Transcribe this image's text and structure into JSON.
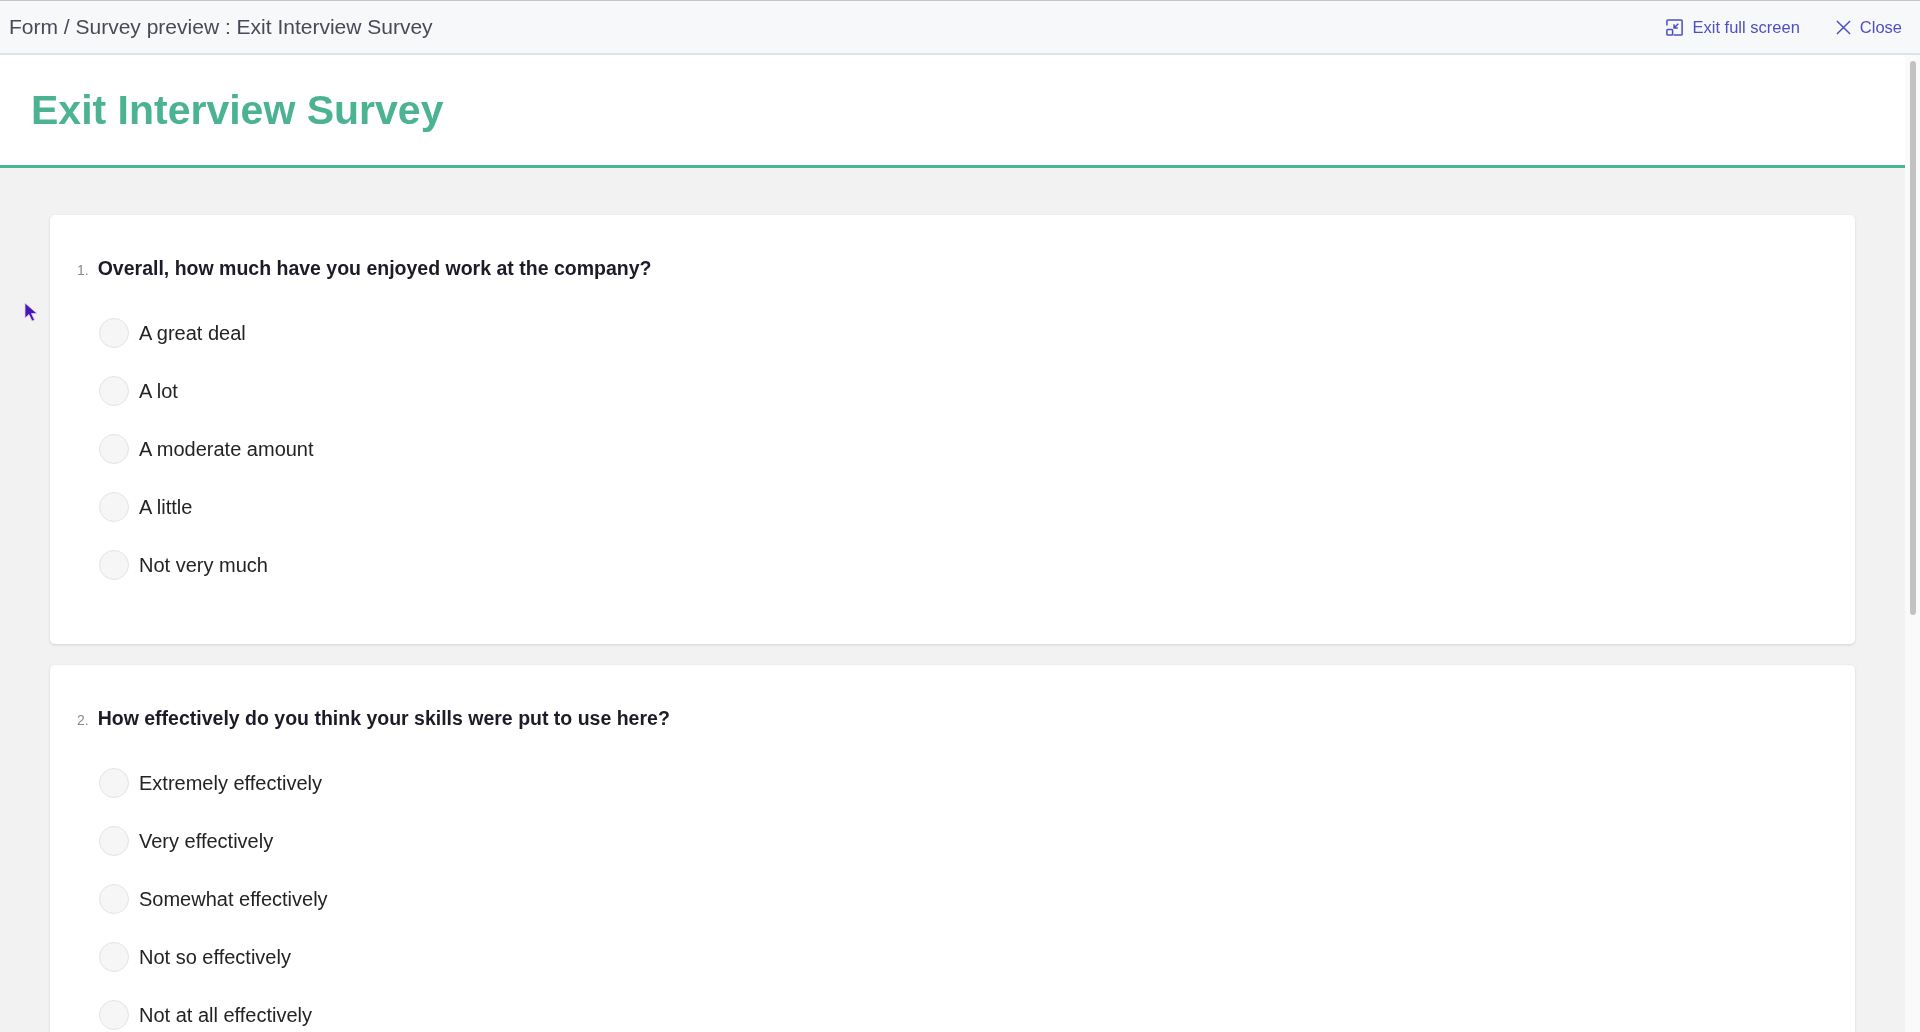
{
  "top_bar": {
    "breadcrumb": "Form / Survey preview : Exit Interview Survey",
    "actions": [
      {
        "kind": "exit_full_screen",
        "label": "Exit full screen"
      },
      {
        "kind": "close",
        "label": "Close"
      }
    ]
  },
  "header": {
    "title": "Exit Interview Survey"
  },
  "questions": [
    {
      "number": "1.",
      "text": "Overall, how much have you enjoyed work at the company?",
      "options": [
        {
          "label": "A great deal",
          "selected": false
        },
        {
          "label": "A lot",
          "selected": false
        },
        {
          "label": "A moderate amount",
          "selected": false
        },
        {
          "label": "A little",
          "selected": false
        },
        {
          "label": "Not very much",
          "selected": false
        }
      ]
    },
    {
      "number": "2.",
      "text": "How effectively do you think your skills were put to use here?",
      "options": [
        {
          "label": "Extremely effectively",
          "selected": false
        },
        {
          "label": "Very effectively",
          "selected": false
        },
        {
          "label": "Somewhat effectively",
          "selected": false
        },
        {
          "label": "Not so effectively",
          "selected": false
        },
        {
          "label": "Not at all effectively",
          "selected": false
        }
      ]
    }
  ]
}
